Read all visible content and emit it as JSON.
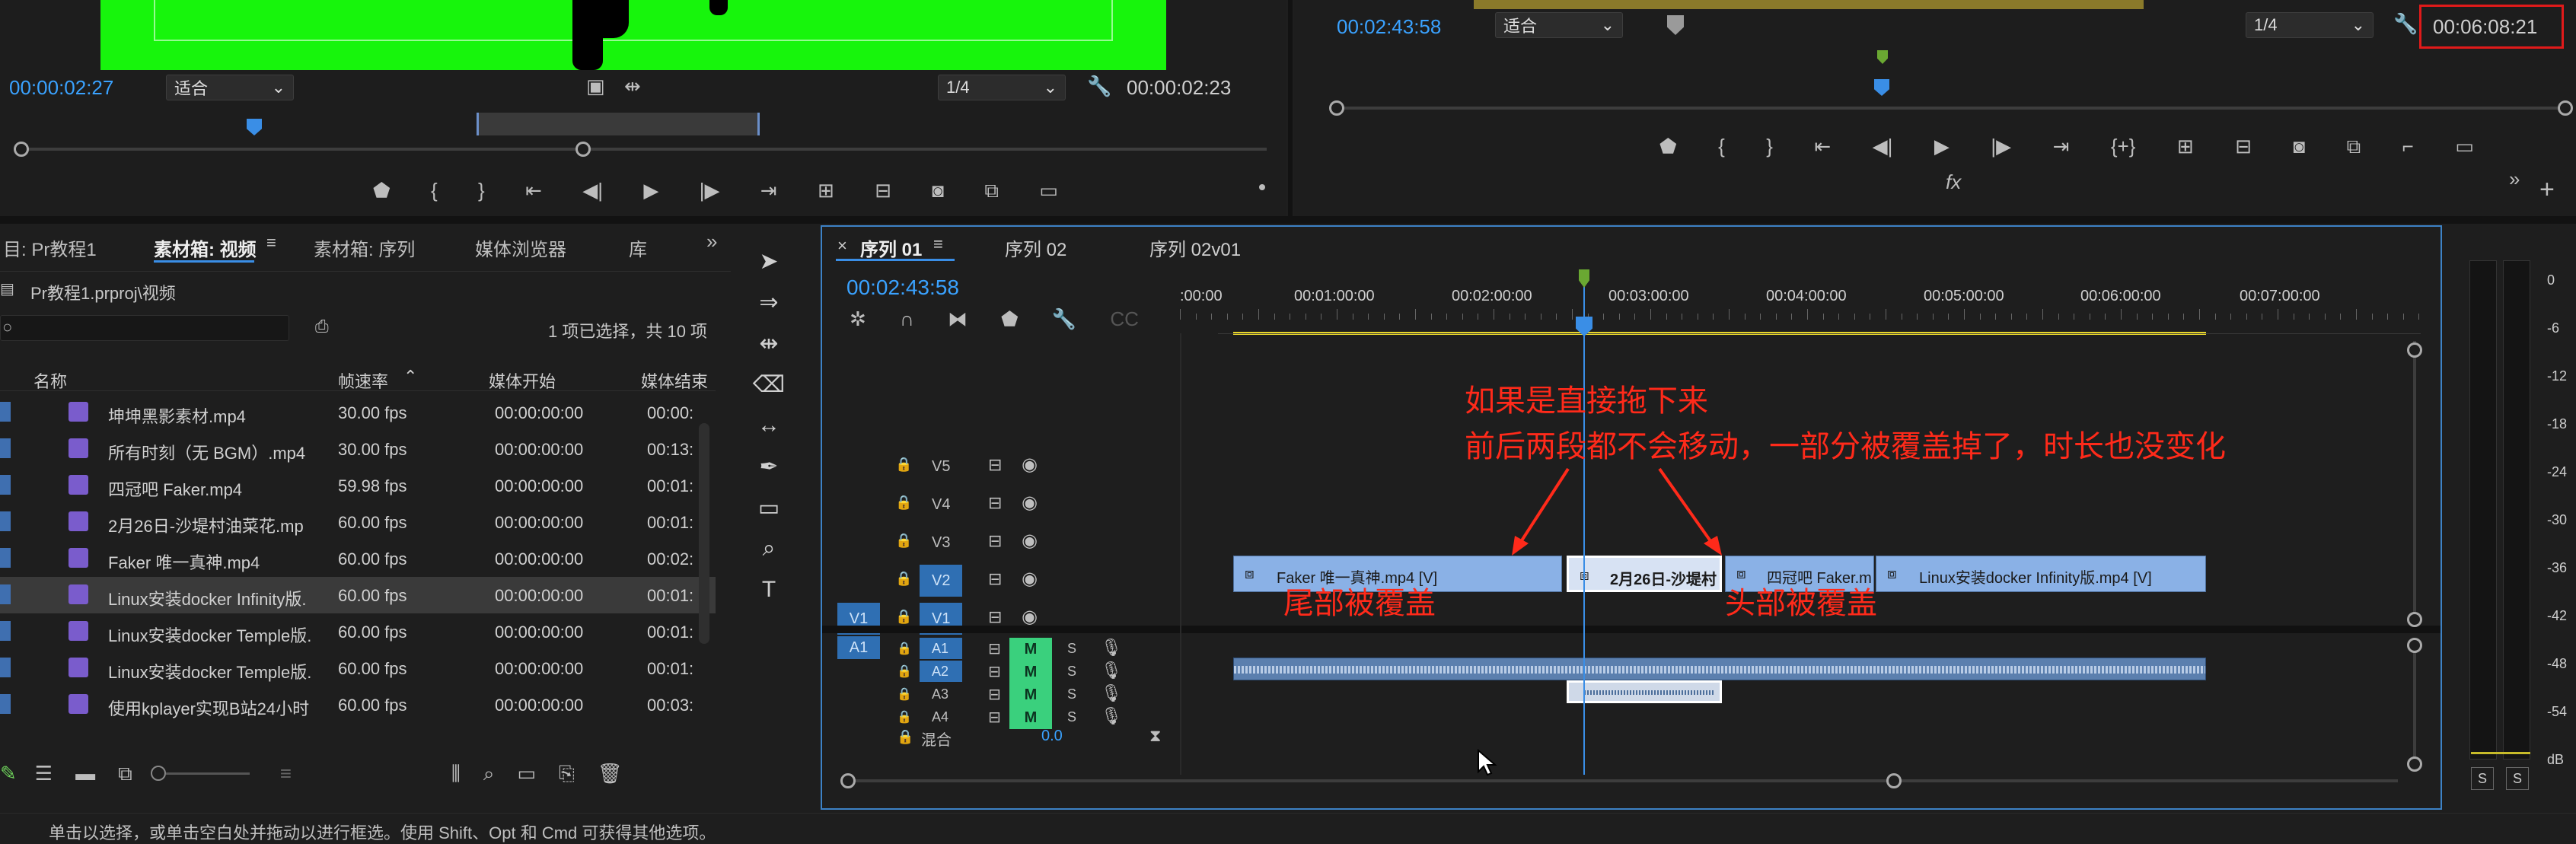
{
  "source_monitor": {
    "timecode_left": "00:00:02:27",
    "fit": "适合",
    "quality": "1/4",
    "timecode_right": "00:00:02:23"
  },
  "program_monitor": {
    "timecode_left": "00:02:43:58",
    "fit": "适合",
    "quality": "1/4",
    "duration": "00:06:08:21"
  },
  "project": {
    "tabs": [
      "目: Pr教程1",
      "素材箱: 视频",
      "素材箱: 序列",
      "媒体浏览器",
      "库"
    ],
    "path": "Pr教程1.prproj\\视频",
    "selection": "1 项已选择，共 10 项",
    "columns": [
      "名称",
      "帧速率",
      "媒体开始",
      "媒体结束"
    ],
    "rows": [
      {
        "name": "坤坤黑影素材.mp4",
        "fps": "30.00 fps",
        "start": "00:00:00:00",
        "end": "00:00:"
      },
      {
        "name": "所有时刻（无 BGM）.mp4",
        "fps": "30.00 fps",
        "start": "00:00:00:00",
        "end": "00:13:"
      },
      {
        "name": "四冠吧 Faker.mp4",
        "fps": "59.98 fps",
        "start": "00:00:00:00",
        "end": "00:01:"
      },
      {
        "name": "2月26日-沙堤村油菜花.mp",
        "fps": "60.00 fps",
        "start": "00:00:00:00",
        "end": "00:01:"
      },
      {
        "name": "Faker 唯一真神.mp4",
        "fps": "60.00 fps",
        "start": "00:00:00:00",
        "end": "00:02:"
      },
      {
        "name": "Linux安装docker Infinity版.",
        "fps": "60.00 fps",
        "start": "00:00:00:00",
        "end": "00:01:"
      },
      {
        "name": "Linux安装docker Temple版.",
        "fps": "60.00 fps",
        "start": "00:00:00:00",
        "end": "00:01:"
      },
      {
        "name": "Linux安装docker Temple版.",
        "fps": "60.00 fps",
        "start": "00:00:00:00",
        "end": "00:01:"
      },
      {
        "name": "使用kplayer实现B站24小时",
        "fps": "60.00 fps",
        "start": "00:00:00:00",
        "end": "00:03:"
      }
    ]
  },
  "timeline": {
    "tabs": [
      "序列 01",
      "序列 02",
      "序列 02v01"
    ],
    "timecode": "00:02:43:58",
    "ruler": [
      ":00:00",
      "00:01:00:00",
      "00:02:00:00",
      "00:03:00:00",
      "00:04:00:00",
      "00:05:00:00",
      "00:06:00:00",
      "00:07:00:00"
    ],
    "video_tracks": [
      "V5",
      "V4",
      "V3",
      "V2",
      "V1"
    ],
    "audio_tracks": [
      "A1",
      "A2",
      "A3",
      "A4"
    ],
    "src_v": "V1",
    "src_a": "A1",
    "m": "M",
    "s": "S",
    "mix_label": "混合",
    "mix_value": "0.0",
    "clips": {
      "c1": "Faker 唯一真神.mp4 [V]",
      "c2": "2月26日-沙堤村",
      "c3": "四冠吧 Faker.m",
      "c4": "Linux安装docker Infinity版.mp4 [V]"
    }
  },
  "annotations": {
    "line1": "如果是直接拖下来",
    "line2": "前后两段都不会移动，一部分被覆盖掉了，时长也没变化",
    "tail": "尾部被覆盖",
    "head": "头部被覆盖"
  },
  "meter": {
    "scale": [
      "0",
      "-6",
      "-12",
      "-18",
      "-24",
      "-30",
      "-36",
      "-42",
      "-48",
      "-54",
      "dB"
    ],
    "s": "S"
  },
  "status": "单击以选择，或单击空白处并拖动以进行框选。使用 Shift、Opt 和 Cmd 可获得其他选项。"
}
